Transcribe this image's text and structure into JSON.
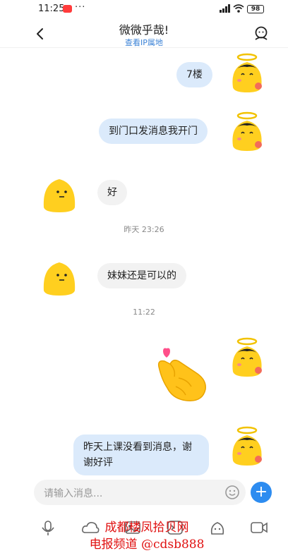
{
  "status": {
    "time": "11:25",
    "dots": "···",
    "battery": "98"
  },
  "header": {
    "title": "微微乎哉!",
    "subtitle": "查看IP属地"
  },
  "messages": [
    {
      "side": "out",
      "text": "7楼"
    },
    {
      "side": "out",
      "text": "到门口发消息我开门"
    },
    {
      "side": "in",
      "text": "好"
    },
    {
      "side": "in",
      "text": "妹妹还是可以的"
    },
    {
      "side": "out",
      "text": "昨天上课没看到消息，谢谢好评"
    }
  ],
  "timestamps": [
    "昨天 23:26",
    "11:22"
  ],
  "input": {
    "placeholder": "请输入消息..."
  },
  "toolbar": {
    "icons": [
      "mic-icon",
      "cloud-icon",
      "image-icon",
      "sticker-icon",
      "emoji-icon",
      "video-icon"
    ]
  },
  "watermark": {
    "line1": "成都楼凤拾贝网",
    "line2": "电报频道 @cdsb888"
  },
  "colors": {
    "outgoing_bubble": "#dbeafb",
    "incoming_bubble": "#f2f2f2",
    "accent": "#2d8cf0"
  }
}
